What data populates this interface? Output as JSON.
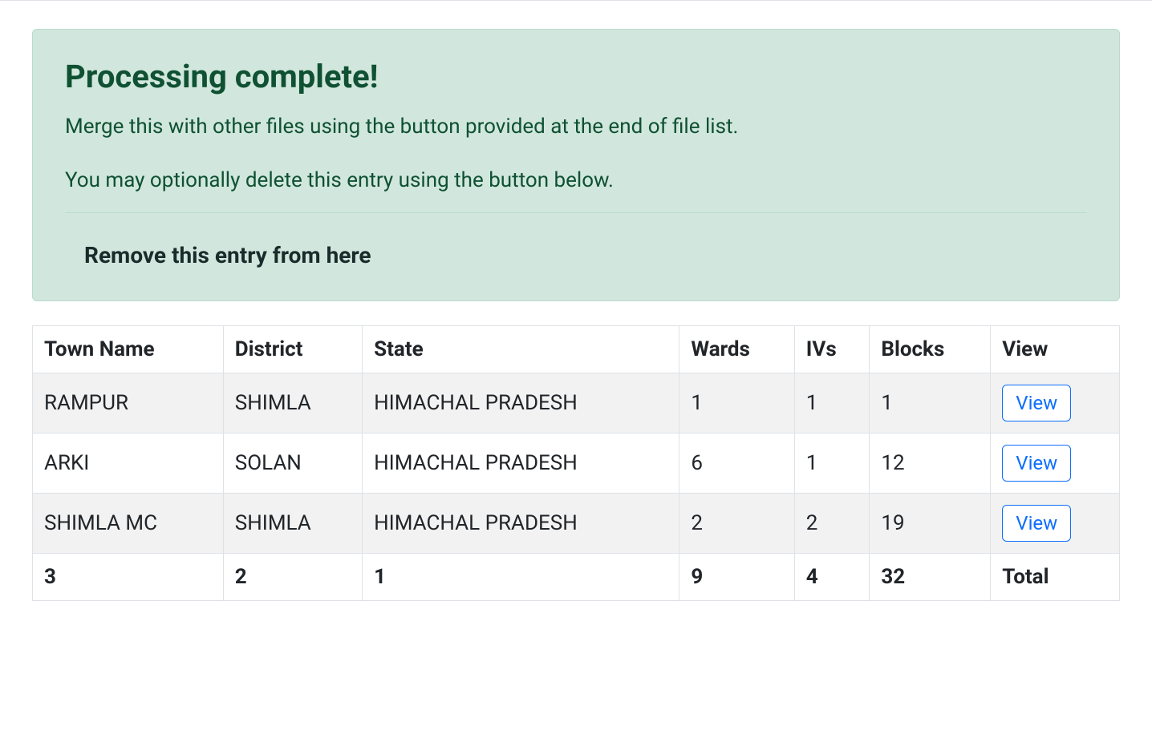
{
  "alert": {
    "heading": "Processing complete!",
    "line1": "Merge this with other files using the button provided at the end of file list.",
    "line2": "You may optionally delete this entry using the button below.",
    "remove_label": "Remove this entry from here"
  },
  "table": {
    "headers": {
      "town": "Town Name",
      "district": "District",
      "state": "State",
      "wards": "Wards",
      "ivs": "IVs",
      "blocks": "Blocks",
      "view": "View"
    },
    "rows": [
      {
        "town": "RAMPUR",
        "district": "SHIMLA",
        "state": "HIMACHAL PRADESH",
        "wards": "1",
        "ivs": "1",
        "blocks": "1",
        "view": "View"
      },
      {
        "town": "ARKI",
        "district": "SOLAN",
        "state": "HIMACHAL PRADESH",
        "wards": "6",
        "ivs": "1",
        "blocks": "12",
        "view": "View"
      },
      {
        "town": "SHIMLA MC",
        "district": "SHIMLA",
        "state": "HIMACHAL PRADESH",
        "wards": "2",
        "ivs": "2",
        "blocks": "19",
        "view": "View"
      }
    ],
    "totals": {
      "town": "3",
      "district": "2",
      "state": "1",
      "wards": "9",
      "ivs": "4",
      "blocks": "32",
      "view": "Total"
    }
  }
}
